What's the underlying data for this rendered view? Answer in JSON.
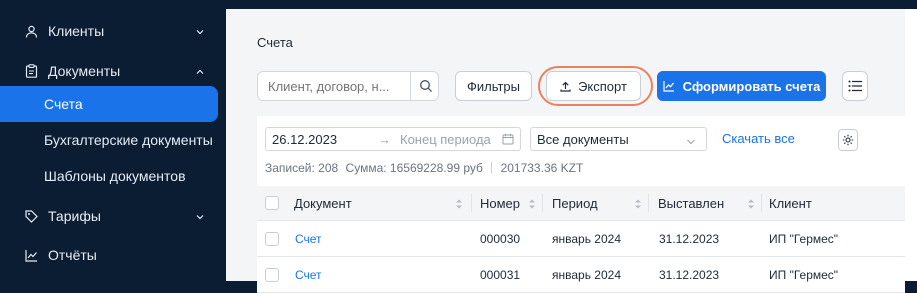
{
  "sidebar": {
    "items": [
      {
        "label": "Клиенты",
        "icon": "user-icon"
      },
      {
        "label": "Документы",
        "icon": "clipboard-icon"
      },
      {
        "label": "Тарифы",
        "icon": "tag-icon"
      },
      {
        "label": "Отчёты",
        "icon": "chart-line-icon"
      }
    ],
    "sub_items": [
      {
        "label": "Счета"
      },
      {
        "label": "Бухгалтерские документы"
      },
      {
        "label": "Шаблоны документов"
      }
    ]
  },
  "breadcrumb": "Счета",
  "search": {
    "placeholder": "Клиент, договор, н..."
  },
  "toolbar": {
    "filters_label": "Фильтры",
    "export_label": "Экспорт",
    "generate_label": "Сформировать счета"
  },
  "filters": {
    "date_from": "26.12.2023",
    "date_to_placeholder": "Конец периода",
    "doc_type": "Все документы",
    "download_all": "Скачать все"
  },
  "summary": {
    "records": "Записей: 208",
    "sum": "Сумма: 16569228.99 руб",
    "kzt": "201733.36 KZT"
  },
  "table": {
    "columns": [
      "Документ",
      "Номер",
      "Период",
      "Выставлен",
      "Клиент"
    ],
    "rows": [
      [
        "Счет",
        "000030",
        "январь 2024",
        "31.12.2023",
        "ИП \"Гермес\""
      ],
      [
        "Счет",
        "000031",
        "январь 2024",
        "31.12.2023",
        "ИП \"Гермес\""
      ]
    ]
  },
  "colors": {
    "accent": "#1a73e8",
    "sidebar": "#0b1d33",
    "highlight_ring": "#e8825e"
  }
}
